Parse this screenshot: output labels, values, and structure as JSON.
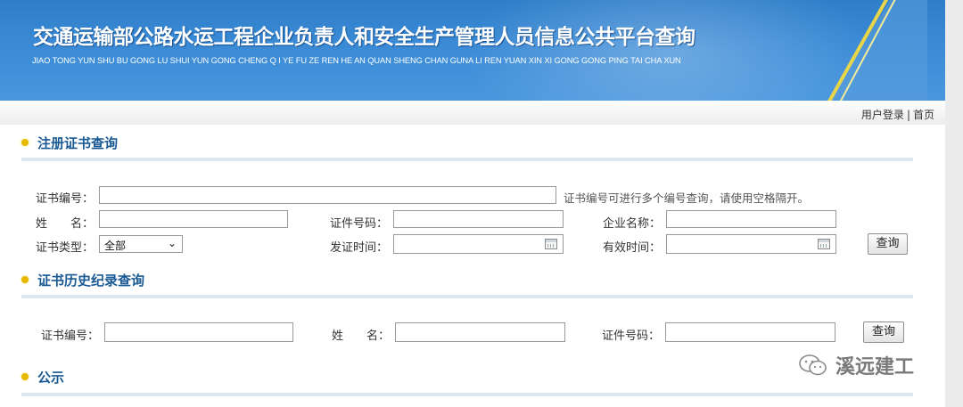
{
  "header": {
    "title": "交通运输部公路水运工程企业负责人和安全生产管理人员信息公共平台查询",
    "subtitle": "JIAO TONG YUN SHU BU GONG LU SHUI YUN GONG CHENG Q I YE FU ZE REN HE AN QUAN SHENG CHAN GUNA LI REN YUAN XIN XI GONG GONG PING TAI CHA XUN"
  },
  "topnav": {
    "login": "用户登录",
    "separator": "|",
    "home": "首页"
  },
  "register_section": {
    "title": "注册证书查询",
    "cert_no_label": "证书编号：",
    "cert_no_value": "",
    "cert_no_hint": "证书编号可进行多个编号查询，请使用空格隔开。",
    "name_label": "姓　　名：",
    "name_value": "",
    "id_label": "证件号码：",
    "id_value": "",
    "company_label": "企业名称：",
    "company_value": "",
    "cert_type_label": "证书类型：",
    "cert_type_selected": "全部",
    "issue_date_label": "发证时间：",
    "valid_date_label": "有效时间：",
    "query_button": "查询"
  },
  "history_section": {
    "title": "证书历史纪录查询",
    "cert_no_label": "证书编号：",
    "name_label": "姓　　名：",
    "id_label": "证件号码：",
    "query_button": "查询"
  },
  "notice_section": {
    "title": "公示"
  },
  "watermark": {
    "text": "溪远建工"
  },
  "colors": {
    "banner": "#3a8ad6",
    "section_title": "#1a5a94",
    "bullet": "#e6b800",
    "section_line": "#dbe8f3"
  }
}
